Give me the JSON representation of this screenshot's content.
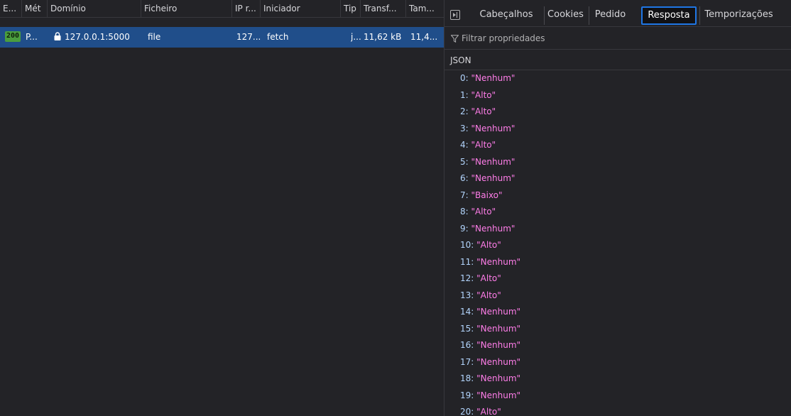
{
  "request_list": {
    "columns": [
      "E...",
      "Mét",
      "Domínio",
      "Ficheiro",
      "IP r...",
      "Iniciador",
      "Tip",
      "Transf...",
      "Tam..."
    ],
    "row": {
      "status": "200",
      "method": "P...",
      "domain": "127.0.0.1:5000",
      "file": "file",
      "ip": "127...",
      "initiator": "fetch",
      "type": "j...",
      "transferred": "11,62 kB",
      "size": "11,4..."
    }
  },
  "details": {
    "tabs": [
      "Cabeçalhos",
      "Cookies",
      "Pedido",
      "Resposta",
      "Temporizações"
    ],
    "active_tab": "Resposta",
    "filter_placeholder": "Filtrar propriedades",
    "json_label": "JSON",
    "json_items": [
      {
        "key": "0",
        "value": "Nenhum"
      },
      {
        "key": "1",
        "value": "Alto"
      },
      {
        "key": "2",
        "value": "Alto"
      },
      {
        "key": "3",
        "value": "Nenhum"
      },
      {
        "key": "4",
        "value": "Alto"
      },
      {
        "key": "5",
        "value": "Nenhum"
      },
      {
        "key": "6",
        "value": "Nenhum"
      },
      {
        "key": "7",
        "value": "Baixo"
      },
      {
        "key": "8",
        "value": "Alto"
      },
      {
        "key": "9",
        "value": "Nenhum"
      },
      {
        "key": "10",
        "value": "Alto"
      },
      {
        "key": "11",
        "value": "Nenhum"
      },
      {
        "key": "12",
        "value": "Alto"
      },
      {
        "key": "13",
        "value": "Alto"
      },
      {
        "key": "14",
        "value": "Nenhum"
      },
      {
        "key": "15",
        "value": "Nenhum"
      },
      {
        "key": "16",
        "value": "Nenhum"
      },
      {
        "key": "17",
        "value": "Nenhum"
      },
      {
        "key": "18",
        "value": "Nenhum"
      },
      {
        "key": "19",
        "value": "Nenhum"
      },
      {
        "key": "20",
        "value": "Alto"
      }
    ]
  },
  "icons": {
    "lock": "lock-icon",
    "filter": "filter-icon",
    "panel_toggle": "sidebar-toggle-icon"
  },
  "colors": {
    "selected_row": "#204e8a",
    "status_ok": "#4a9e3e",
    "active_tab_border": "#1f76e5",
    "json_key": "#b3d5fd",
    "json_value": "#ff7de9"
  }
}
